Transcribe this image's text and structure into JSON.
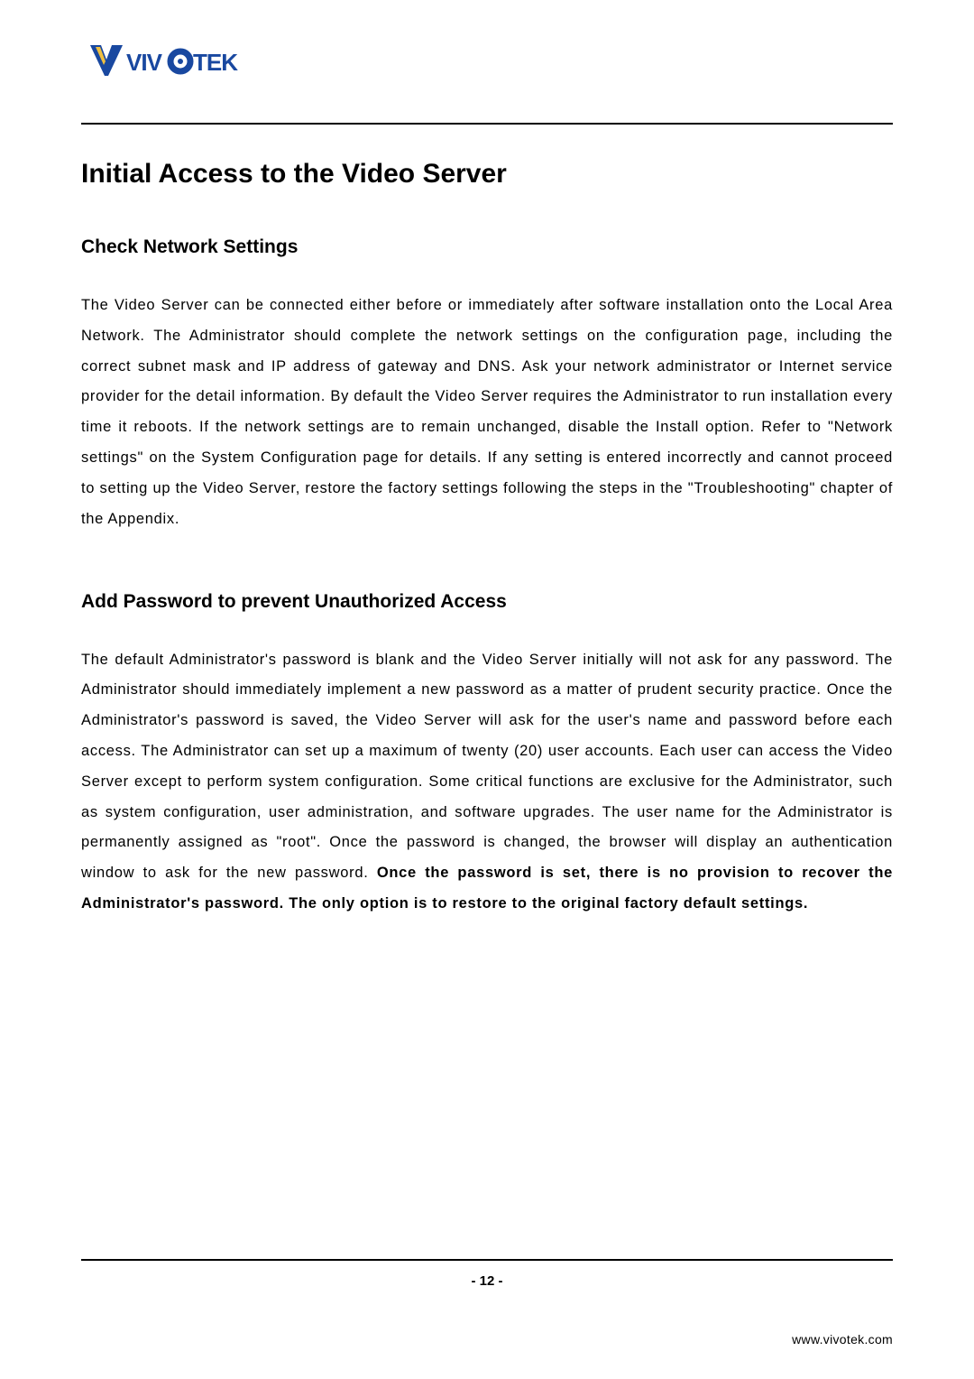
{
  "logo": {
    "brand_name": "VIVOTEK",
    "colors": {
      "primary_blue": "#1948a0",
      "accent_yellow": "#f0c040"
    }
  },
  "headings": {
    "main": "Initial Access to the Video Server",
    "section1": "Check Network Settings",
    "section2": "Add Password to prevent Unauthorized Access"
  },
  "paragraphs": {
    "p1": "The Video Server can be connected either before or immediately after software installation onto the Local Area Network. The Administrator should complete the network settings on the configuration page, including the correct subnet mask and IP address of gateway and DNS. Ask your network administrator or Internet service provider for the detail information. By default the Video Server requires the Administrator to run installation every time it reboots. If the network settings are to remain unchanged, disable the Install option. Refer to \"Network settings\" on the System Configuration page for details. If any setting is entered incorrectly and cannot proceed to setting up the Video Server, restore the factory settings following the steps in the \"Troubleshooting\" chapter of the Appendix.",
    "p2_part1": "The default Administrator's password is blank and the Video Server initially will not ask for any password. The Administrator should immediately implement a new password as a matter of prudent security practice. Once the Administrator's password is saved, the Video Server will ask for the user's name and password before each access. The Administrator can set up a maximum of twenty (20) user accounts. Each user can access the Video Server except to perform system configuration. Some critical functions are exclusive for the Administrator, such as system configuration, user administration, and software upgrades. The user name for the Administrator is permanently assigned as \"root\". Once the password is changed, the browser will display an authentication window to ask for the new password.  ",
    "p2_bold": "Once the password is set, there is no provision to recover the Administrator's password.  The only option is to restore to the original factory default settings."
  },
  "footer": {
    "page_number": "- 12 -",
    "url": "www.vivotek.com"
  }
}
